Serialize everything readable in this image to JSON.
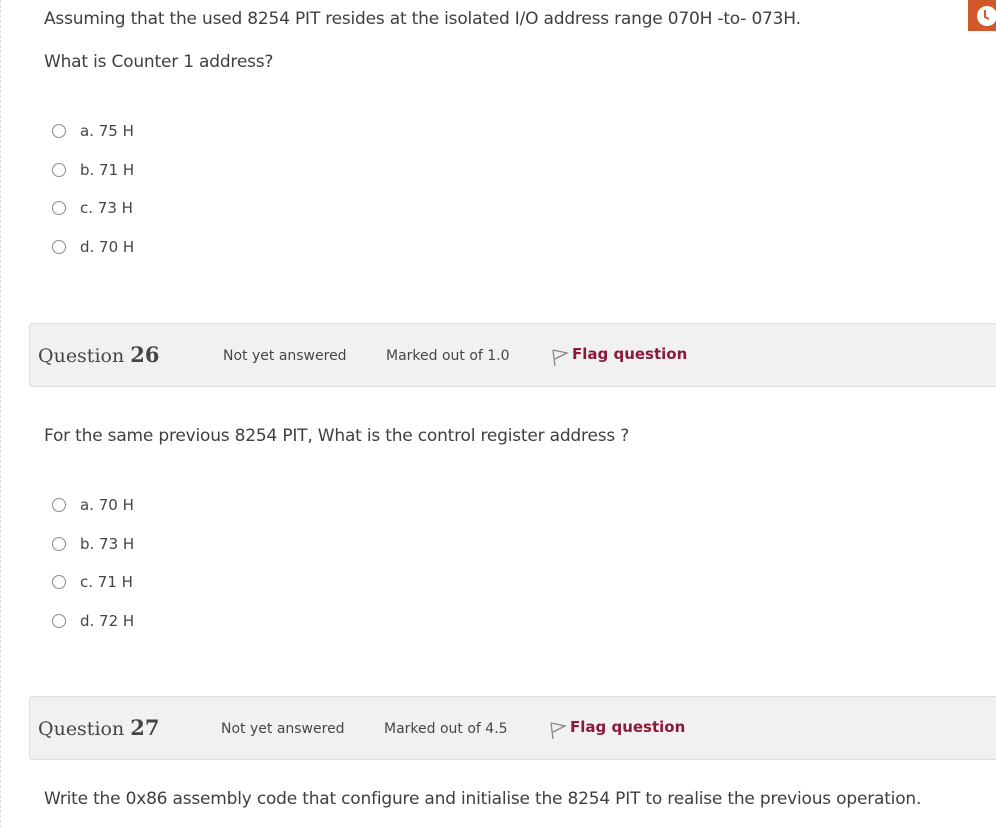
{
  "timer": {
    "icon": "clock-icon",
    "color": "#d0582b"
  },
  "question25": {
    "text_line1": "Assuming that the used 8254 PIT resides at the isolated I/O address range 070H -to-  073H.",
    "text_line2": "What is Counter 1 address?",
    "answers": [
      {
        "label": "a. 75 H",
        "selected": false
      },
      {
        "label": "b. 71 H",
        "selected": false
      },
      {
        "label": "c. 73 H",
        "selected": false
      },
      {
        "label": "d. 70 H",
        "selected": false
      }
    ]
  },
  "question26": {
    "prefix": "Question ",
    "number": "26",
    "state": "Not yet answered",
    "grade": "Marked out of 1.0",
    "flag_label": "Flag question",
    "text": "For the same previous  8254 PIT, What is the control register address ?",
    "answers": [
      {
        "label": "a. 70 H",
        "selected": false
      },
      {
        "label": "b. 73 H",
        "selected": false
      },
      {
        "label": "c. 71 H",
        "selected": false
      },
      {
        "label": "d. 72 H",
        "selected": false
      }
    ]
  },
  "question27": {
    "prefix": "Question ",
    "number": "27",
    "state": "Not yet answered",
    "grade": "Marked out of 4.5",
    "flag_label": "Flag question",
    "text": "Write the 0x86 assembly code that configure and initialise the 8254 PIT to realise the previous operation."
  },
  "colors": {
    "flag_text": "#8b1a3a",
    "header_bg": "#f1f1f1",
    "timer_bg": "#d0582b"
  }
}
